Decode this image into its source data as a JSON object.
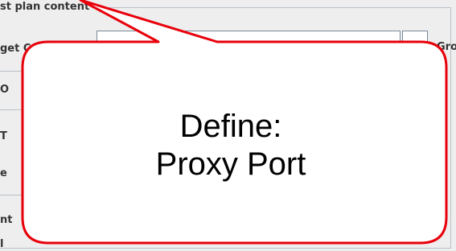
{
  "panel": {
    "legend": "st plan content",
    "rows": {
      "row1_label": "get C",
      "row2_label": "O",
      "row3_label": "T",
      "row4_label": "e",
      "row5_label": "nt",
      "row6_label": "l"
    },
    "right_label": "Gro"
  },
  "callout": {
    "line1": "Define:",
    "line2": "Proxy Port",
    "border_color": "#e8000b",
    "fill_color": "#ffffff"
  }
}
